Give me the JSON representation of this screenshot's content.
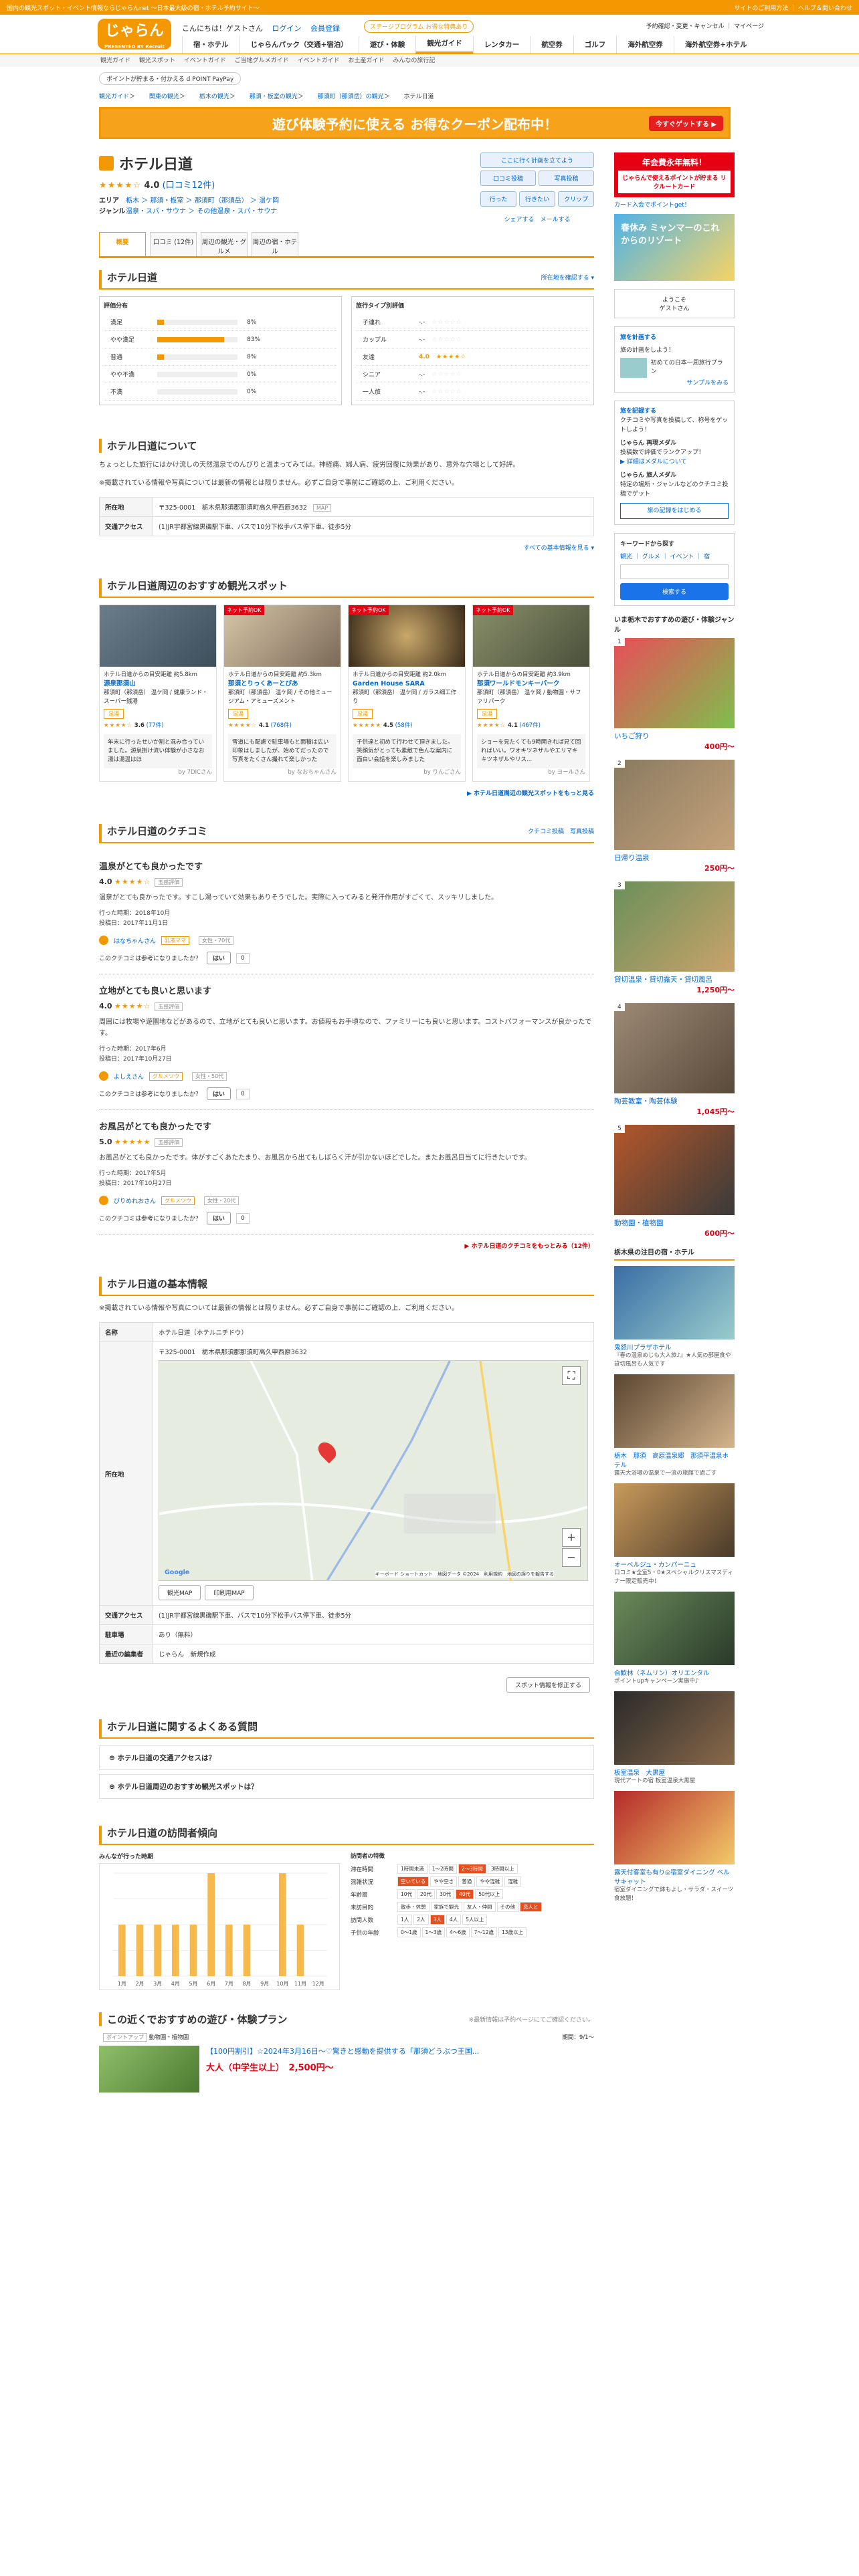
{
  "topbar": {
    "left": "国内の観光スポット・イベント情報ならじゃらんnet ～日本最大級の宿・ホテル予約サイト～",
    "right": "サイトのご利用方法 ｜ ヘルプ＆問い合わせ"
  },
  "header": {
    "logo": "じゃらん",
    "logo_sub": "PRESENTED BY Recruit",
    "greeting": "こんにちは！ゲストさん",
    "login": "ログイン",
    "register": "会員登録",
    "stage": "ステージプログラム お得な特典あり",
    "links": "予約確認・変更・キャンセル ｜ マイページ"
  },
  "nav": [
    "宿・ホテル",
    "じゃらんパック（交通+宿泊）",
    "遊び・体験",
    "観光ガイド",
    "レンタカー",
    "航空券",
    "ゴルフ",
    "海外航空券",
    "海外航空券+ホテル"
  ],
  "subnav": [
    "観光ガイド",
    "観光スポット",
    "イベントガイド",
    "ご当地グルメガイド",
    "イベントガイド",
    "お土産ガイド",
    "みんなの旅行記"
  ],
  "pointbar": "ポイントが貯まる・付かえる d POINT PayPay",
  "crumb": [
    "観光ガイド",
    "関東の観光",
    "栃木の観光",
    "那須・板室の観光",
    "那須町（那須岳）の観光",
    "ホテル日道"
  ],
  "banner": {
    "text": "遊び体験予約に使える お得なクーポン配布中！",
    "btn": "今すぐゲットする ▶"
  },
  "spot": {
    "title": "ホテル日道",
    "rating": "4.0",
    "reviews": "(口コミ12件)",
    "area_label": "エリア",
    "area": "栃木 ＞ 那須・板室 ＞ 那須町（那須岳） ＞ 温ケ岡",
    "genre_label": "ジャンル",
    "genre": "温泉・スパ・サウナ ＞ その他温泉・スパ・サウナ",
    "actions": [
      "ここに行く計画を立てよう",
      "口コミ投稿",
      "写真投稿",
      "行った",
      "行きたい",
      "クリップ",
      "シェアする",
      "メールする"
    ]
  },
  "tabs": [
    "概要",
    "口コミ (12件)",
    "周辺の観光・グルメ",
    "周辺の宿・ホテル"
  ],
  "eval": {
    "heading": "ホテル日道",
    "link": "所在地を確認する ▾",
    "left_title": "評価分布",
    "right_title": "旅行タイプ別評価",
    "dist": [
      {
        "label": "満足",
        "pct": 8
      },
      {
        "label": "やや満足",
        "pct": 83
      },
      {
        "label": "普通",
        "pct": 8
      },
      {
        "label": "やや不満",
        "pct": 0
      },
      {
        "label": "不満",
        "pct": 0
      }
    ],
    "types": [
      {
        "label": "子連れ",
        "score": "-.-"
      },
      {
        "label": "カップル",
        "score": "-.-"
      },
      {
        "label": "友達",
        "score": "4.0"
      },
      {
        "label": "シニア",
        "score": "-.-"
      },
      {
        "label": "一人旅",
        "score": "-.-"
      }
    ]
  },
  "about": {
    "heading": "ホテル日道について",
    "text": "ちょっとした旅行にはかけ流しの天然温泉でのんびりと温まってみては。神経痛、婦人病、疲労回復に効果があり、意外な穴場として好評。",
    "note": "※掲載されている情報や写真については最新の情報とは限りません。必ずご自身で事前にご確認の上、ご利用ください。",
    "addr_k": "所在地",
    "addr": "〒325-0001　栃木県那須郡那須町高久甲西原3632",
    "map": "MAP",
    "access_k": "交通アクセス",
    "access": "(1)JR宇都宮線黒磯駅下車、バスで10分下松手バス停下車、徒歩5分",
    "more": "すべての基本情報を見る ▾"
  },
  "nearby": {
    "heading": "ホテル日道周辺のおすすめ観光スポット",
    "more": "▶ ホテル日道周辺の観光スポットをもっと見る",
    "items": [
      {
        "badge": "",
        "dist": "ホテル日道からの目安距離 約5.8km",
        "name": "源泉那須山",
        "area": "那須町（那須岳） 温ケ岡 / 健康ランド・スーパー銭湯",
        "tag": "足湯",
        "rating": "3.6",
        "cnt": "(77件)",
        "cmt": "年末に行ったせいか割と混み合っていました。源泉掛け流い体験が小さなお湯は湯温はほ",
        "by": "by 7DICさん"
      },
      {
        "badge": "ネット予約OK",
        "dist": "ホテル日道からの目安距離 約5.3km",
        "name": "那須とりっくあーとぴあ",
        "area": "那須町（那須岳） 温ケ岡 / その他ミュージアム・アミューズメント",
        "tag": "足湯",
        "rating": "4.1",
        "cnt": "(768件)",
        "cmt": "雪道にも配慮で駐車場もと面積は広い印象はしましたが、始めてだったので写真をたくさん撮れて楽しかった",
        "by": "by なおちゃんさん"
      },
      {
        "badge": "ネット予約OK",
        "dist": "ホテル日道からの目安距離 約2.0km",
        "name": "Garden House SARA",
        "area": "那須町（那須岳） 温ケ岡 / ガラス細工作り",
        "tag": "足湯",
        "rating": "4.5",
        "cnt": "(58件)",
        "cmt": "子供達と初めて行わせて頂きました。笑顔気がとっても素敵で色んな案内に面白い会話を楽しみました",
        "by": "by りんごさん"
      },
      {
        "badge": "ネット予約OK",
        "dist": "ホテル日道からの目安距離 約3.9km",
        "name": "那須ワールドモンキーパーク",
        "area": "那須町（那須岳） 温ケ岡 / 動物園・サファリパーク",
        "tag": "足湯",
        "rating": "4.1",
        "cnt": "(467件)",
        "cmt": "ショーを見たくても9時開きれば見て回ればいい。ワオキツネザルやエリマキキツネザルやリス...",
        "by": "by ヨールさん"
      }
    ]
  },
  "reviews": {
    "heading": "ホテル日道のクチコミ",
    "post": "クチコミ投稿",
    "photo": "写真投稿",
    "question": "このクチコミは参考になりましたか？",
    "yes": "はい",
    "more": "▶ ホテル日道のクチコミをもっとみる（12件）",
    "items": [
      {
        "title": "温泉がとても良かったです",
        "score": "4.0",
        "badge": "五感評価",
        "text": "温泉がとても良かったです。すこし湯っていて効果もありそうでした。実際に入ってみると発汗作用がすごくて、スッキリしました。",
        "went": "行った時期：2018年10月",
        "posted": "投稿日：2017年11月1日",
        "user": "はなちゃんさん",
        "utag": "乳液ママ",
        "uage": "女性・70代",
        "cnt": "0"
      },
      {
        "title": "立地がとても良いと思います",
        "score": "4.0",
        "badge": "五感評価",
        "text": "周囲には牧場や遊園地などがあるので、立地がとても良いと思います。お値段もお手頃なので、ファミリーにも良いと思います。コストパフォーマンスが良かったです。",
        "went": "行った時期：2017年6月",
        "posted": "投稿日：2017年10月27日",
        "user": "よしえさん",
        "utag": "グルメツウ",
        "uage": "女性・50代",
        "cnt": "0"
      },
      {
        "title": "お風呂がとても良かったです",
        "score": "5.0",
        "badge": "五感評価",
        "text": "お風呂がとても良かったです。体がすごくあたたまり、お風呂から出てもしばらく汗が引かないほどでした。またお風呂目当てに行きたいです。",
        "went": "行った時期：2017年5月",
        "posted": "投稿日：2017年10月27日",
        "user": "ぴりめれおさん",
        "utag": "グルメツウ",
        "uage": "女性・20代",
        "cnt": "0"
      }
    ]
  },
  "basic": {
    "heading": "ホテル日道の基本情報",
    "note": "※掲載されている情報や写真については最新の情報とは限りません。必ずご自身で事前にご確認の上、ご利用ください。",
    "name_k": "名称",
    "name": "ホテル日道（ホテルニチドウ）",
    "addr_k": "所在地",
    "addr": "〒325-0001　栃木県那須郡那須町高久甲西原3632",
    "map_btn": "観光MAP",
    "print_btn": "印刷用MAP",
    "access_k": "交通アクセス",
    "access": "(1)JR宇都宮線黒磯駅下車、バスで10分下松手バス停下車、徒歩5分",
    "park_k": "駐車場",
    "park": "あり（無料）",
    "editor_k": "最近の編集者",
    "editor": "じゃらん　新規作成",
    "map_credit": "キーボード ショートカット　地図データ ©2024　利用規約　地図の誤りを報告する",
    "fix": "スポット情報を修正する"
  },
  "faq": {
    "heading": "ホテル日道に関するよくある質問",
    "items": [
      "ホテル日道の交通アクセスは？",
      "ホテル日道周辺のおすすめ観光スポットは？"
    ]
  },
  "trend": {
    "heading": "ホテル日道の訪問者傾向",
    "left_title": "みんなが行った時期",
    "right_title": "訪問者の特徴",
    "rows": [
      {
        "k": "滞在時間",
        "v": [
          "1時間未満",
          "1〜2時間",
          "2〜3時間",
          "3時間以上"
        ],
        "h": 2
      },
      {
        "k": "混雑状況",
        "v": [
          "空いている",
          "やや空き",
          "普通",
          "やや混雑",
          "混雑"
        ],
        "h": 0
      },
      {
        "k": "年齢層",
        "v": [
          "10代",
          "20代",
          "30代",
          "40代",
          "50代以上"
        ],
        "h": 3
      },
      {
        "k": "来訪目的",
        "v": [
          "散歩・休憩",
          "家族で観光",
          "友人・仲間",
          "その他",
          "恋人と"
        ],
        "h": 4
      },
      {
        "k": "訪問人数",
        "v": [
          "1人",
          "2人",
          "3人",
          "4人",
          "5人以上"
        ],
        "h": 2
      },
      {
        "k": "子供の年齢",
        "v": [
          "0〜1歳",
          "1〜3歳",
          "4〜6歳",
          "7〜12歳",
          "13歳以上"
        ],
        "h": -1
      }
    ]
  },
  "chart_data": {
    "type": "bar",
    "categories": [
      "1月",
      "2月",
      "3月",
      "4月",
      "5月",
      "6月",
      "7月",
      "8月",
      "9月",
      "10月",
      "11月",
      "12月"
    ],
    "values": [
      1,
      1,
      1,
      1,
      1,
      2,
      1,
      1,
      0,
      2,
      1,
      0
    ],
    "ylim": [
      0,
      2
    ]
  },
  "plans": {
    "heading": "この近くでおすすめの遊び・体験プラン",
    "note": "※最新情報は予約ページにてご確認ください。",
    "tag": "ポイントアップ",
    "genre": "動物園・植物園",
    "date": "期間：9/1〜",
    "title": "【100円割引】☆2024年3月16日〜♡驚きと感動を提供する「那須どうぶつ王国...",
    "price_label": "大人（中学生以上）",
    "price": "2,500円〜"
  },
  "side": {
    "coupon": "年会費永年無料！",
    "card": "じゃらんで使えるポイントが貯まる リクルートカード",
    "card_note": "カード入会でポイントget！",
    "promo": "春休み ミャンマーのこれからのリゾート",
    "welcome": "ようこそ",
    "guest": "ゲストさん",
    "plan_title": "旅を計画する",
    "plan_text": "旅の計画をしよう！",
    "plan_sub": "初めての日本一周旅行プラン",
    "plan_link": "サンプルをみる",
    "rec_title": "旅を記録する",
    "rec_text": "クチコミや写真を投稿して、称号をゲットしよう！",
    "medal_title": "じゃらん 再現メダル",
    "medal_text": "投稿数で評価でランクアップ！",
    "medal_link": "▶ 詳細はメダルについて",
    "guide_title": "じゃらん 旅人メダル",
    "guide_text": "特定の場所・ジャンルなどのクチコミ投稿でゲット",
    "rec_btn": "旅の記録をはじめる",
    "kw_title": "キーワードから探す",
    "kw_tabs": "観光 ｜ グルメ ｜ イベント ｜ 宿",
    "search": "検索する",
    "rank_title": "いま栃木でおすすめの遊び・体験ジャンル",
    "ranks": [
      {
        "n": "1",
        "name": "いちご狩り",
        "price": "400円〜"
      },
      {
        "n": "2",
        "name": "日帰り温泉",
        "price": "250円〜"
      },
      {
        "n": "3",
        "name": "貸切温泉・貸切露天・貸切風呂",
        "price": "1,250円〜"
      },
      {
        "n": "4",
        "name": "陶芸教室・陶芸体験",
        "price": "1,045円〜"
      },
      {
        "n": "5",
        "name": "動物園・植物園",
        "price": "600円〜"
      }
    ],
    "hotel_title": "栃木県の注目の宿・ホテル",
    "hotels": [
      {
        "name": "鬼怒川プラザホテル",
        "desc": "『春の温泉めじも大人旅♪』★人気の部屋食や貸切風呂も人気です"
      },
      {
        "name": "栃木　那須　高原温泉郷　那須平温泉ホテル",
        "desc": "露天大浴場の温泉で一流の旅館で過ごす"
      },
      {
        "name": "オーベルジュ・カンパーニュ",
        "desc": "口コミ★全室5・0★スペシャルクリスマスディナー限定販売中！"
      },
      {
        "name": "合歓林（ネムリン）オリエンタル",
        "desc": "ポイントupキャンペーン実施中♪"
      },
      {
        "name": "板室温泉　大黒屋",
        "desc": "現代アートの宿 板室温泉大黒屋"
      },
      {
        "name": "露天付客室も有り◎宿室ダイニング ベルサキャット",
        "desc": "宿室ダイニングで鉢もよし・サラダ・スイーツ食放題！"
      }
    ]
  }
}
